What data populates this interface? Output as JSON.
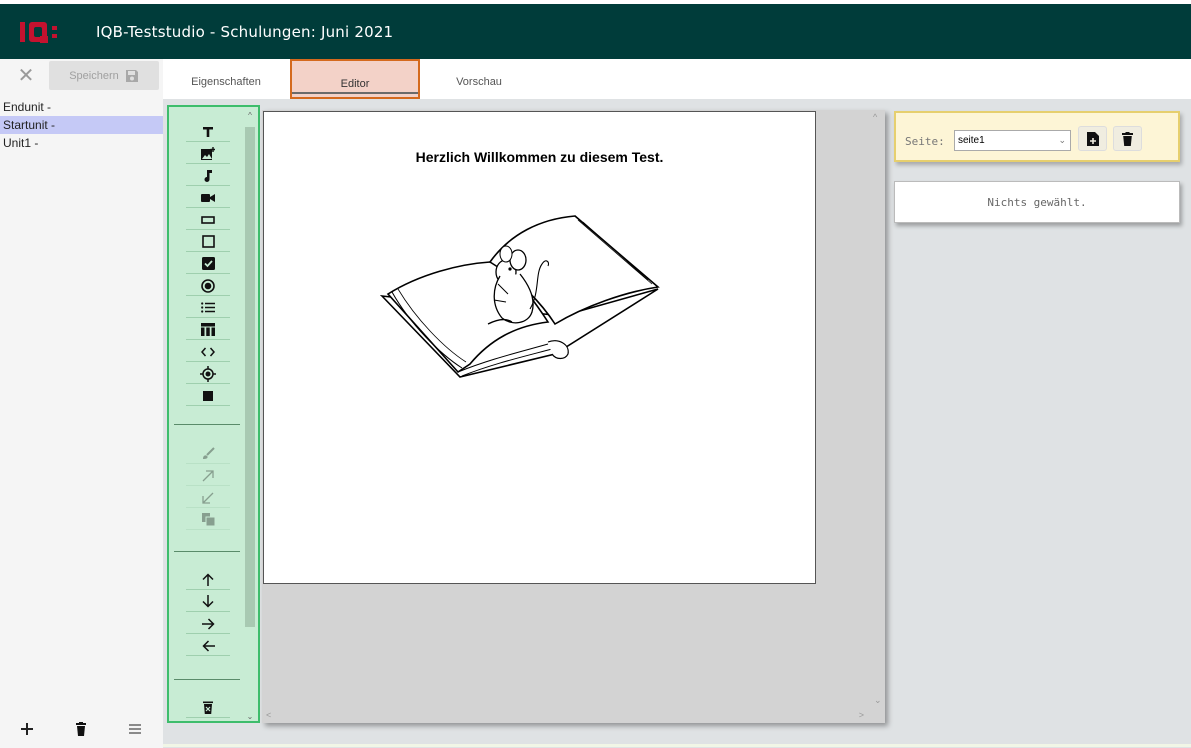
{
  "header": {
    "app_title": "IQB-Teststudio - Schulungen: Juni 2021",
    "logo_text": "IQB"
  },
  "left_panel": {
    "save_label": "Speichern",
    "units": [
      {
        "label": "Endunit -"
      },
      {
        "label": "Startunit -",
        "selected": true
      },
      {
        "label": "Unit1 -"
      }
    ]
  },
  "tabs": [
    {
      "label": "Eigenschaften"
    },
    {
      "label": "Editor",
      "active": true
    },
    {
      "label": "Vorschau"
    }
  ],
  "canvas": {
    "page_title": "Herzlich Willkommen zu diesem Test."
  },
  "page_panel": {
    "seite_label": "Seite:",
    "selected_page": "seite1"
  },
  "properties": {
    "empty_text": "Nichts gewählt."
  },
  "colors": {
    "header_bg": "#003c3a",
    "toolbox_bg": "#c8ecd4",
    "toolbox_border": "#3ebd6c",
    "active_tab_bg": "#f3d2c8",
    "active_tab_border": "#d46a1e",
    "selected_unit": "#c5c9f6",
    "page_panel_bg": "#fdf5d6"
  },
  "toolbox_icons": {
    "insert": [
      "text-icon",
      "image-icon",
      "audio-icon",
      "video-icon",
      "text-field-icon",
      "text-area-icon",
      "checkbox-icon",
      "radio-icon",
      "list-icon",
      "table-icon",
      "code-icon",
      "hotspot-icon",
      "block-icon"
    ],
    "edit_disabled": [
      "brush-icon",
      "arrow-up-right-icon",
      "arrow-down-left-icon",
      "duplicate-icon"
    ],
    "move": [
      "arrow-up-icon",
      "arrow-down-icon",
      "arrow-right-icon",
      "arrow-left-icon"
    ],
    "delete": [
      "delete-element-icon"
    ]
  }
}
